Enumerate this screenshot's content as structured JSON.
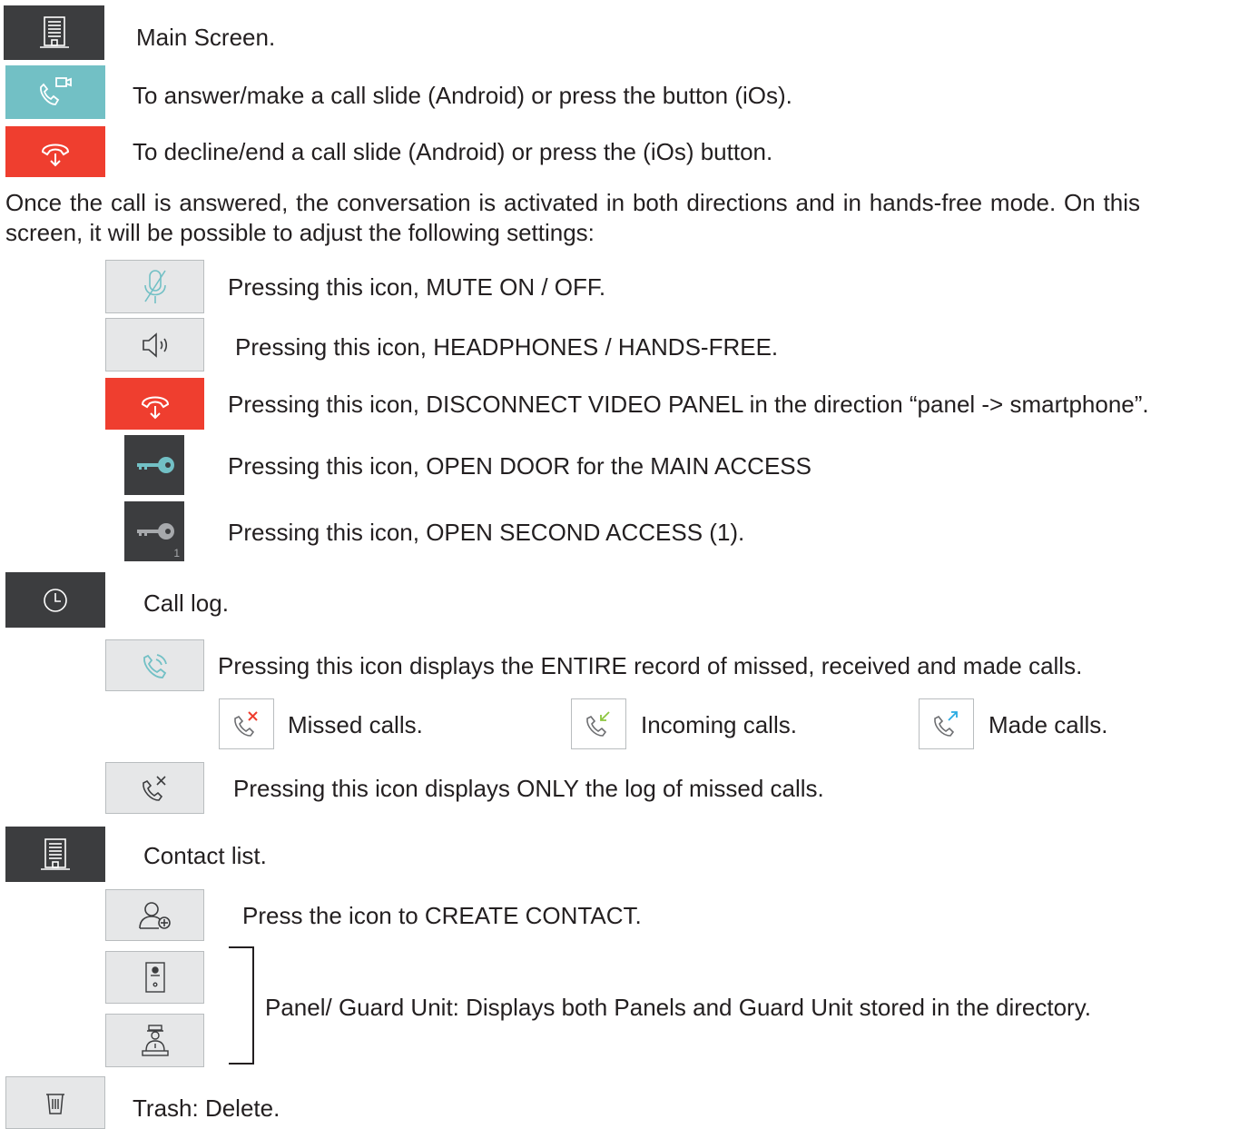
{
  "colors": {
    "dark": "#3c3d3f",
    "teal": "#72c0c5",
    "red": "#ef3e2f",
    "light": "#e6e7e8",
    "text": "#231f20"
  },
  "items": {
    "main_screen": {
      "label": "Main Screen.",
      "icon": "building-icon"
    },
    "answer": {
      "label": "To answer/make a call slide (Android) or press the button (iOs).",
      "icon": "phone-video-icon"
    },
    "decline": {
      "label": "To decline/end a call slide (Android) or press the (iOs) button.",
      "icon": "hangup-icon"
    }
  },
  "intro": "Once the call is answered, the conversation is activated in both directions and in hands-free mode. On this screen, it will be possible to adjust the following settings:",
  "settings": {
    "mute": "Pressing this icon, MUTE ON / OFF.",
    "speaker": "Pressing this icon, HEADPHONES / HANDS-FREE.",
    "disconnect": "Pressing this icon, DISCONNECT VIDEO PANEL in the direction “panel -> smartphone”.",
    "open_main": "Pressing this icon, OPEN DOOR for the MAIN ACCESS",
    "open_second": "Pressing this icon, OPEN SECOND ACCESS (1).",
    "key_badge": "1"
  },
  "call_log": {
    "label": "Call log.",
    "entire": "Pressing this icon displays the ENTIRE record of missed, received and made calls.",
    "missed": "Missed calls.",
    "incoming": "Incoming calls.",
    "made": "Made calls.",
    "only_missed": "Pressing this icon displays ONLY the log of missed calls."
  },
  "contacts": {
    "label": "Contact list.",
    "create": "Press the icon to CREATE CONTACT.",
    "panel_guard": "Panel/ Guard Unit: Displays both Panels and Guard Unit stored in the directory."
  },
  "trash": {
    "label": "Trash: Delete."
  }
}
